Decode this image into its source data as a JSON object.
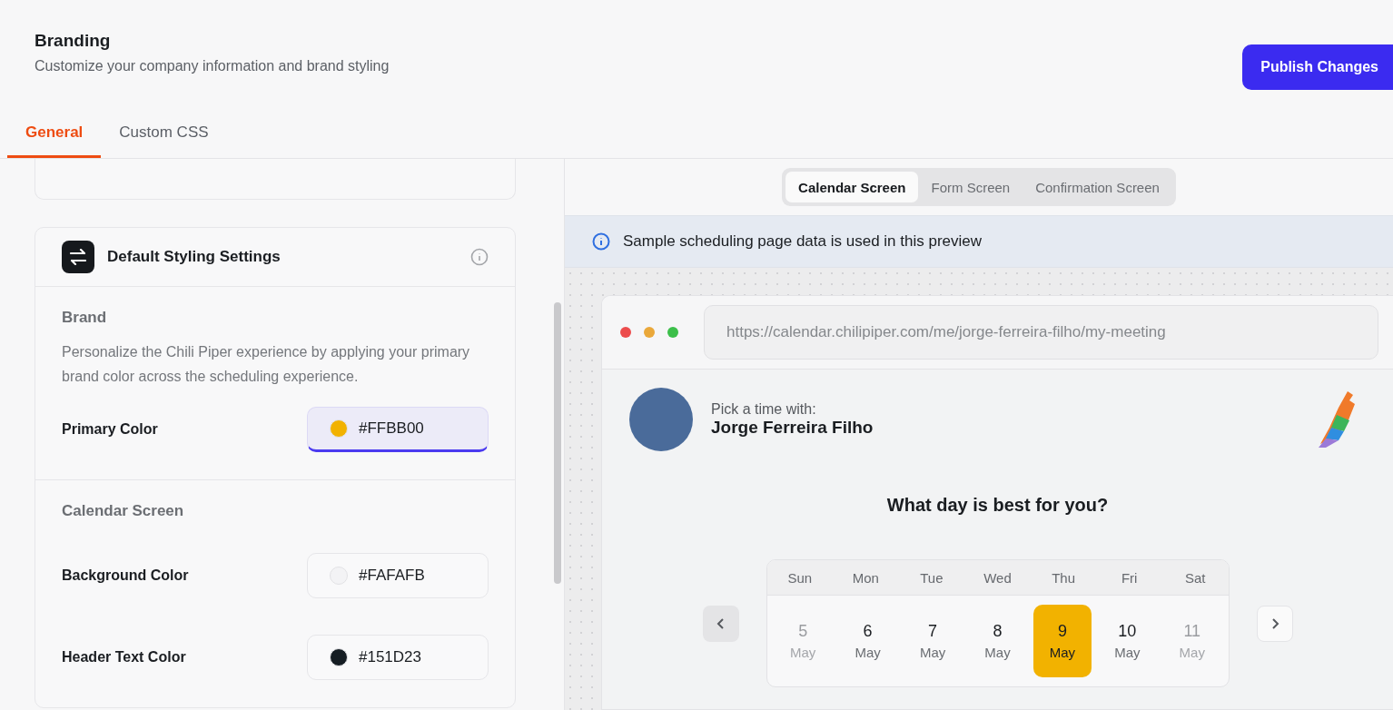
{
  "header": {
    "title": "Branding",
    "subtitle": "Customize your company information and brand styling",
    "publish_button": "Publish Changes"
  },
  "tabs": [
    {
      "label": "General",
      "selected": true
    },
    {
      "label": "Custom CSS",
      "selected": false
    }
  ],
  "settings_card": {
    "title": "Default Styling Settings",
    "sections": [
      {
        "heading": "Brand",
        "description": "Personalize the Chili Piper experience by applying your primary brand color across the scheduling experience.",
        "fields": [
          {
            "label": "Primary Color",
            "value": "#FFBB00",
            "color": "#f2b200",
            "focused": true
          }
        ]
      },
      {
        "heading": "Calendar Screen",
        "fields": [
          {
            "label": "Background Color",
            "value": "#FAFAFB",
            "color": "#f3f3f5",
            "focused": false
          },
          {
            "label": "Header Text Color",
            "value": "#151D23",
            "color": "#151d23",
            "focused": false
          }
        ]
      }
    ]
  },
  "preview": {
    "screens": [
      {
        "label": "Calendar Screen",
        "selected": true
      },
      {
        "label": "Form Screen",
        "selected": false
      },
      {
        "label": "Confirmation Screen",
        "selected": false
      }
    ],
    "notice": "Sample scheduling page data is used in this preview",
    "url": "https://calendar.chilipiper.com/me/jorge-ferreira-filho/my-meeting",
    "host_prompt": "Pick a time with:",
    "host_name": "Jorge Ferreira Filho",
    "question": "What day is best for you?",
    "weekdays": [
      "Sun",
      "Mon",
      "Tue",
      "Wed",
      "Thu",
      "Fri",
      "Sat"
    ],
    "days": [
      {
        "day": "5",
        "month": "May",
        "disabled": true,
        "selected": false
      },
      {
        "day": "6",
        "month": "May",
        "disabled": false,
        "selected": false
      },
      {
        "day": "7",
        "month": "May",
        "disabled": false,
        "selected": false
      },
      {
        "day": "8",
        "month": "May",
        "disabled": false,
        "selected": false
      },
      {
        "day": "9",
        "month": "May",
        "disabled": false,
        "selected": true
      },
      {
        "day": "10",
        "month": "May",
        "disabled": false,
        "selected": false
      },
      {
        "day": "11",
        "month": "May",
        "disabled": true,
        "selected": false
      }
    ]
  }
}
